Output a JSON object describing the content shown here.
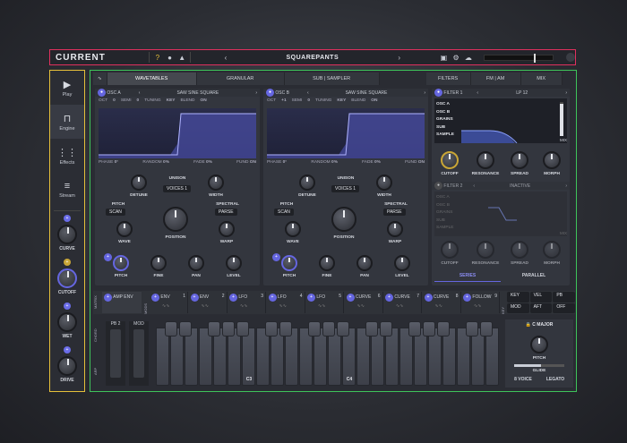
{
  "app": {
    "logo": "CURRENT",
    "help_icon": "?",
    "preset_name": "SQUAREPANTS",
    "prev": "‹",
    "next": "›"
  },
  "sidebar": {
    "items": [
      {
        "label": "Play",
        "icon": "play-icon"
      },
      {
        "label": "Engine",
        "icon": "engine-icon"
      },
      {
        "label": "Effects",
        "icon": "effects-icon"
      },
      {
        "label": "Stream",
        "icon": "stream-icon"
      }
    ],
    "macros": [
      {
        "label": "CURVE"
      },
      {
        "label": "CUTOFF"
      },
      {
        "label": "WET"
      },
      {
        "label": "DRIVE"
      }
    ]
  },
  "tabs": {
    "wavetables": "WAVETABLES",
    "granular": "GRANULAR",
    "sub_sampler": "SUB | SAMPLER",
    "filters": "FILTERS",
    "fm_am": "FM | AM",
    "mix": "MIX"
  },
  "osc_a": {
    "title": "OSC A",
    "wave": "SAW SINE SQUARE",
    "oct_l": "OCT",
    "oct": "0",
    "semi_l": "SEMI",
    "semi": "0",
    "tuning_l": "TUNING",
    "tuning": "KEY",
    "blend_l": "BLEND",
    "blend": "ON",
    "phase_l": "PHASE",
    "phase": "0°",
    "random_l": "RANDOM",
    "random": "0%",
    "fade_l": "FADE",
    "fade": "0%",
    "fund_l": "FUND",
    "fund": "ON",
    "detune": "DETUNE",
    "unison": "UNISON",
    "voices_l": "VOICES",
    "voices": "1",
    "width": "WIDTH",
    "pitch_l": "PITCH",
    "scan": "SCAN",
    "spectral": "SPECTRAL",
    "parse": "PARSE",
    "wave_k": "WAVE",
    "position": "POSITION",
    "warp": "WARP",
    "pitch_k": "PITCH",
    "fine": "FINE",
    "pan": "PAN",
    "level": "LEVEL"
  },
  "osc_b": {
    "title": "OSC B",
    "wave": "SAW SINE SQUARE",
    "oct_l": "OCT",
    "oct": "+1",
    "semi_l": "SEMI",
    "semi": "0",
    "tuning_l": "TUNING",
    "tuning": "KEY",
    "blend_l": "BLEND",
    "blend": "ON",
    "phase_l": "PHASE",
    "phase": "0°",
    "random_l": "RANDOM",
    "random": "0%",
    "fade_l": "FADE",
    "fade": "0%",
    "fund_l": "FUND",
    "fund": "ON",
    "detune": "DETUNE",
    "unison": "UNISON",
    "voices_l": "VOICES",
    "voices": "1",
    "width": "WIDTH",
    "pitch_l": "PITCH",
    "scan": "SCAN",
    "spectral": "SPECTRAL",
    "parse": "PARSE",
    "wave_k": "WAVE",
    "position": "POSITION",
    "warp": "WARP",
    "pitch_k": "PITCH",
    "fine": "FINE",
    "pan": "PAN",
    "level": "LEVEL"
  },
  "filter1": {
    "title": "FILTER 1",
    "type": "LP 12",
    "sources": [
      "OSC A",
      "OSC B",
      "GRAINS",
      "SUB",
      "SAMPLE"
    ],
    "mix": "MIX",
    "cutoff": "CUTOFF",
    "resonance": "RESONANCE",
    "spread": "SPREAD",
    "morph": "MORPH"
  },
  "filter2": {
    "title": "FILTER 2",
    "state": "INACTIVE",
    "sources": [
      "OSC A",
      "OSC B",
      "GRAINS",
      "SUB",
      "SAMPLE"
    ],
    "mix": "MIX",
    "cutoff": "CUTOFF",
    "resonance": "RESONANCE",
    "spread": "SPREAD",
    "morph": "MORPH",
    "series": "SERIES",
    "parallel": "PARALLEL"
  },
  "mod": {
    "matrix": "MATRIX",
    "mods": "MODS",
    "amp_env": "AMP ENV",
    "slots": [
      {
        "name": "ENV",
        "n": "1"
      },
      {
        "name": "ENV",
        "n": "2"
      },
      {
        "name": "LFO",
        "n": "3"
      },
      {
        "name": "LFO",
        "n": "4"
      },
      {
        "name": "LFO",
        "n": "5"
      },
      {
        "name": "CURVE",
        "n": "6"
      },
      {
        "name": "CURVE",
        "n": "7"
      },
      {
        "name": "CURVE",
        "n": "8"
      },
      {
        "name": "FOLLOW",
        "n": "9"
      }
    ],
    "key": "KEY",
    "vel": "VEL",
    "pb": "PB",
    "mod_btn": "MOD",
    "aft": "AFT",
    "off": "OFF",
    "key_side": "KEY"
  },
  "keys": {
    "pb": "PB",
    "pb_v": "2",
    "mod": "MOD",
    "chord": "CHORD",
    "arp": "ARP",
    "c3": "C3",
    "c4": "C4",
    "scale": "C MAJOR",
    "pitch": "PITCH",
    "glide": "GLIDE",
    "voice": "8 VOICE",
    "legato": "LEGATO"
  },
  "colors": {
    "accent": "#6566e0",
    "topbar_border": "#e0305e",
    "sidebar_border": "#e6c03a",
    "main_border": "#3ec45a"
  }
}
